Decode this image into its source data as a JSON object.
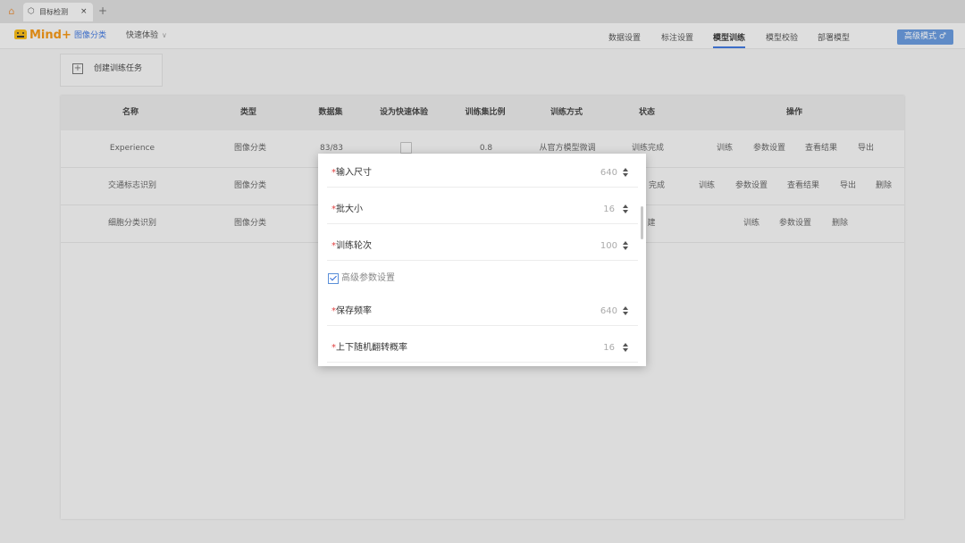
{
  "tabstrip": {
    "tab_title": "目标检测",
    "close": "×",
    "new_tab": "+"
  },
  "header": {
    "logo": "Mind+",
    "mode": "图像分类",
    "quick": "快速体验",
    "steps": [
      "数据设置",
      "标注设置",
      "模型训练",
      "模型校验",
      "部署模型"
    ],
    "active_step": "模型训练",
    "advanced_button": "高级模式 ♂"
  },
  "create_task": {
    "label": "创建训练任务"
  },
  "table": {
    "headers": [
      "名称",
      "类型",
      "数据集",
      "设为快速体验",
      "训练集比例",
      "训练方式",
      "状态",
      "操作"
    ],
    "rows": [
      {
        "name": "Experience",
        "type": "图像分类",
        "dataset": "83/83",
        "ratio": "0.8",
        "method": "从官方模型微调",
        "status": "训练完成",
        "ops": [
          "训练",
          "参数设置",
          "查看结果",
          "导出"
        ]
      },
      {
        "name": "交通标志识别",
        "type": "图像分类",
        "status": "完成",
        "ops": [
          "训练",
          "参数设置",
          "查看结果",
          "导出",
          "删除"
        ]
      },
      {
        "name": "细胞分类识别",
        "type": "图像分类",
        "status": "建",
        "ops": [
          "训练",
          "参数设置",
          "删除"
        ]
      }
    ]
  },
  "modal": {
    "fields": [
      {
        "label": "输入尺寸",
        "value": "640"
      },
      {
        "label": "批大小",
        "value": "16"
      },
      {
        "label": "训练轮次",
        "value": "100"
      }
    ],
    "advanced_label": "高级参数设置",
    "advanced_fields": [
      {
        "label": "保存频率",
        "value": "640"
      },
      {
        "label": "上下随机翻转概率",
        "value": "16"
      }
    ]
  }
}
